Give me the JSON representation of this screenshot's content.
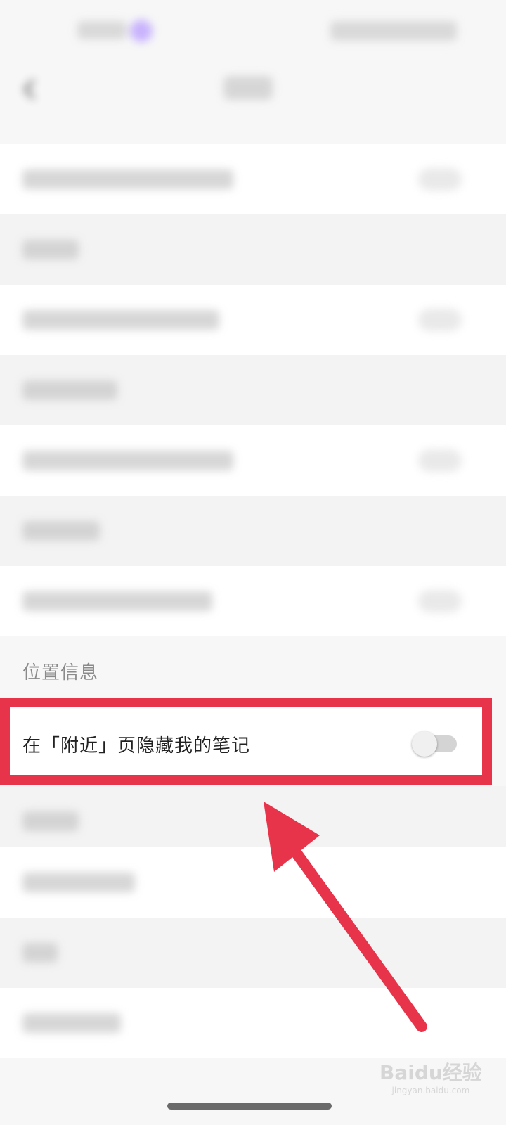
{
  "privacy_section": {
    "label": "位置信息",
    "setting": {
      "label": "在「附近」页隐藏我的笔记",
      "enabled": false
    }
  },
  "annotation": {
    "highlight_color": "#e8344b"
  },
  "watermark": {
    "brand": "Baidu经验",
    "url": "jingyan.baidu.com"
  }
}
